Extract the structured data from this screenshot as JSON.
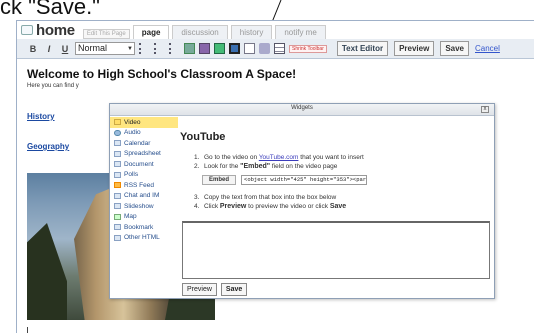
{
  "caption": "ck \"Save.\"",
  "tabs": {
    "home_label": "home",
    "edit_page": "Edit This Page",
    "page": "page",
    "discussion": "discussion",
    "history": "history",
    "notify": "notify me"
  },
  "toolbar": {
    "bold": "B",
    "italic": "I",
    "underline": "U",
    "format_value": "Normal",
    "badge": "Shrink Toolbar",
    "text_editor": "Text Editor",
    "preview": "Preview",
    "save": "Save",
    "cancel": "Cancel"
  },
  "page": {
    "title": "Welcome to High School's Classroom A Space!",
    "intro": "Here you can find y",
    "links": [
      "History",
      "Geography"
    ]
  },
  "dialog": {
    "title": "Widgets",
    "close": "x",
    "sidebar": [
      {
        "label": "Video",
        "icon": "video-icon",
        "active": true
      },
      {
        "label": "Audio",
        "icon": "audio-icon"
      },
      {
        "label": "Calendar",
        "icon": "calendar-icon"
      },
      {
        "label": "Spreadsheet",
        "icon": "spreadsheet-icon"
      },
      {
        "label": "Document",
        "icon": "document-icon"
      },
      {
        "label": "Polls",
        "icon": "polls-icon"
      },
      {
        "label": "RSS Feed",
        "icon": "rss-icon"
      },
      {
        "label": "Chat and IM",
        "icon": "chat-icon"
      },
      {
        "label": "Slideshow",
        "icon": "slideshow-icon"
      },
      {
        "label": "Map",
        "icon": "map-icon"
      },
      {
        "label": "Bookmark",
        "icon": "bookmark-icon"
      },
      {
        "label": "Other HTML",
        "icon": "html-icon"
      }
    ],
    "heading": "YouTube",
    "step1_pre": "Go to the video on ",
    "step1_link": "YouTube.com",
    "step1_post": " that you want to insert",
    "step2_pre": "Look for the ",
    "step2_bold": "\"Embed\"",
    "step2_post": " field on the video page",
    "embed_label": "Embed",
    "embed_value": "<object width=\"425\" height=\"353\"><param name=\"n",
    "step3": "Copy the text from that box into the box below",
    "step4_a": "Click ",
    "step4_b": "Preview",
    "step4_c": " to preview the video or click ",
    "step4_d": "Save",
    "btn_preview": "Preview",
    "btn_save": "Save"
  }
}
